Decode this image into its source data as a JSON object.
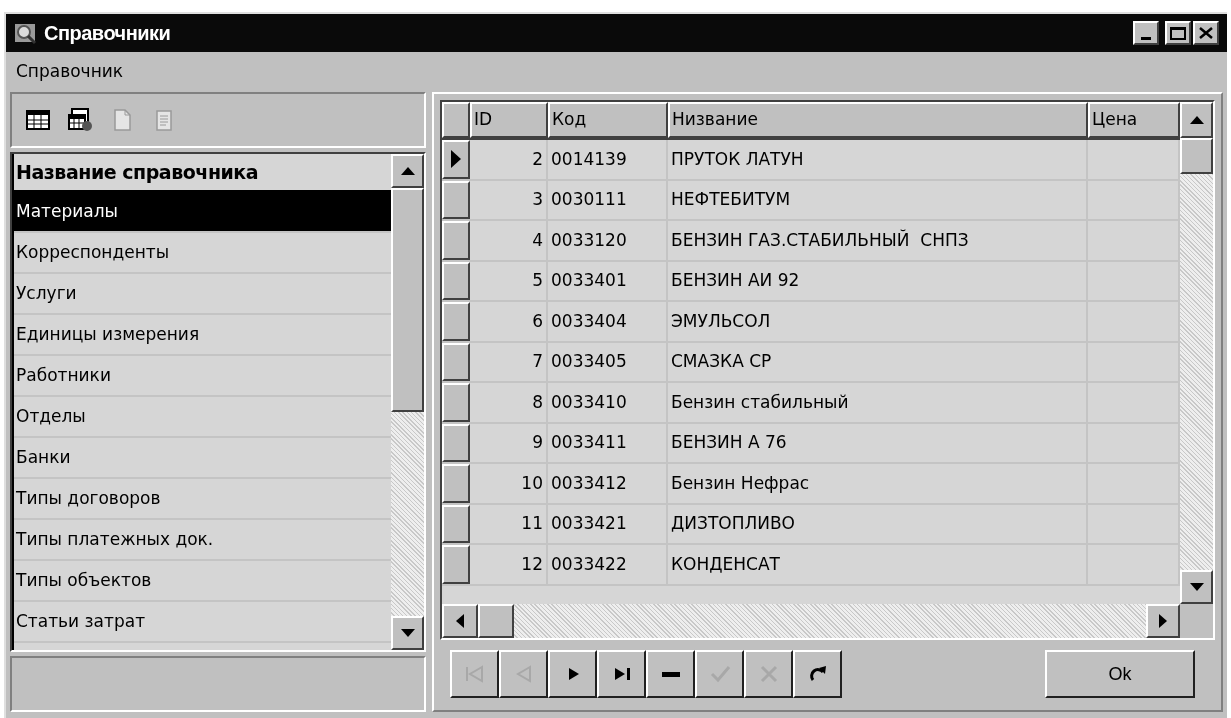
{
  "window": {
    "title": "Справочники"
  },
  "menu": [
    {
      "label": "Справочник"
    }
  ],
  "toolbar": [
    {
      "kind": "grid",
      "disabled": false
    },
    {
      "kind": "grid-refresh",
      "disabled": false
    },
    {
      "kind": "new",
      "disabled": true
    },
    {
      "kind": "edit",
      "disabled": true
    }
  ],
  "catalog_list": {
    "header": "Название справочника",
    "items": [
      {
        "label": "Материалы",
        "selected": true
      },
      {
        "label": "Корреспонденты",
        "selected": false
      },
      {
        "label": "Услуги",
        "selected": false
      },
      {
        "label": "Единицы измерения",
        "selected": false
      },
      {
        "label": "Работники",
        "selected": false
      },
      {
        "label": "Отделы",
        "selected": false
      },
      {
        "label": "Банки",
        "selected": false
      },
      {
        "label": "Типы договоров",
        "selected": false
      },
      {
        "label": "Типы платежных док.",
        "selected": false
      },
      {
        "label": "Типы объектов",
        "selected": false
      },
      {
        "label": "Статьи затрат",
        "selected": false
      }
    ]
  },
  "table": {
    "columns": [
      "ID",
      "Код",
      "Низвание",
      "Цена"
    ],
    "rows": [
      {
        "id": "2",
        "code": "0014139",
        "name": "ПРУТОК ЛАТУН",
        "selected": true
      },
      {
        "id": "3",
        "code": "0030111",
        "name": "НЕФТЕБИТУМ",
        "selected": false
      },
      {
        "id": "4",
        "code": "0033120",
        "name": "БЕНЗИН ГАЗ.СТАБИЛЬНЫЙ  СНПЗ",
        "selected": false
      },
      {
        "id": "5",
        "code": "0033401",
        "name": "БЕНЗИН АИ 92",
        "selected": false
      },
      {
        "id": "6",
        "code": "0033404",
        "name": "ЭМУЛЬСОЛ",
        "selected": false
      },
      {
        "id": "7",
        "code": "0033405",
        "name": "СМАЗКА СР",
        "selected": false
      },
      {
        "id": "8",
        "code": "0033410",
        "name": "Бензин стабильный",
        "selected": false
      },
      {
        "id": "9",
        "code": "0033411",
        "name": "БЕНЗИН А 76",
        "selected": false
      },
      {
        "id": "10",
        "code": "0033412",
        "name": "Бензин Нефрас",
        "selected": false
      },
      {
        "id": "11",
        "code": "0033421",
        "name": "ДИЗТОПЛИВО",
        "selected": false
      },
      {
        "id": "12",
        "code": "0033422",
        "name": "КОНДЕНСАТ",
        "selected": false
      }
    ]
  },
  "navigator": [
    {
      "kind": "first",
      "disabled": true
    },
    {
      "kind": "prior",
      "disabled": true
    },
    {
      "kind": "next",
      "disabled": false
    },
    {
      "kind": "last",
      "disabled": false
    },
    {
      "kind": "delete",
      "disabled": false
    },
    {
      "kind": "post",
      "disabled": true
    },
    {
      "kind": "cancel",
      "disabled": true
    },
    {
      "kind": "refresh",
      "disabled": false
    }
  ],
  "ok_button": {
    "label": "Ok"
  }
}
